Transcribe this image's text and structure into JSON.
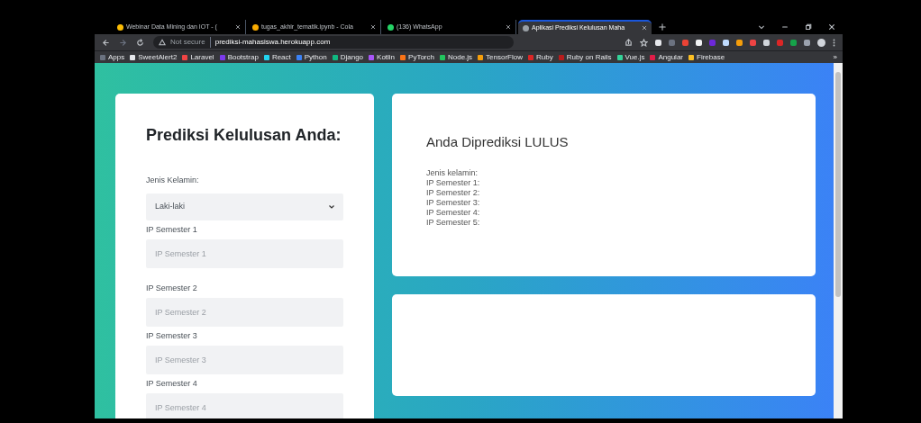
{
  "tabs": [
    {
      "title": "Webinar Data Mining dan IOT - (",
      "selected": false
    },
    {
      "title": "tugas_akhir_tematik.ipynb - Cola",
      "selected": false
    },
    {
      "title": "(136) WhatsApp",
      "selected": false
    },
    {
      "title": "Aplikasi Prediksi Kelulusan Maha",
      "selected": true
    }
  ],
  "address_bar": {
    "security": "Not secure",
    "url": "prediksi-mahasiswa.herokuapp.com"
  },
  "bookmarks": [
    {
      "label": "Apps",
      "color": "#6b7280"
    },
    {
      "label": "SweetAlert2",
      "color": "#e5e7eb"
    },
    {
      "label": "Laravel",
      "color": "#ef4444"
    },
    {
      "label": "Bootstrap",
      "color": "#7c3aed"
    },
    {
      "label": "React",
      "color": "#22d3ee"
    },
    {
      "label": "Python",
      "color": "#3b82f6"
    },
    {
      "label": "Django",
      "color": "#10b981"
    },
    {
      "label": "Kotlin",
      "color": "#a855f7"
    },
    {
      "label": "PyTorch",
      "color": "#f97316"
    },
    {
      "label": "Node.js",
      "color": "#22c55e"
    },
    {
      "label": "TensorFlow",
      "color": "#f59e0b"
    },
    {
      "label": "Ruby",
      "color": "#dc2626"
    },
    {
      "label": "Ruby on Rails",
      "color": "#b91c1c"
    },
    {
      "label": "Vue.js",
      "color": "#34d399"
    },
    {
      "label": "Angular",
      "color": "#e11d48"
    },
    {
      "label": "Firebase",
      "color": "#fbbf24"
    }
  ],
  "bookmarks_more": "»",
  "form": {
    "title": "Prediksi Kelulusan Anda:",
    "gender": {
      "label": "Jenis Kelamin:",
      "value": "Laki-laki"
    },
    "fields": [
      {
        "label": "IP Semester 1",
        "placeholder": "IP Semester 1"
      },
      {
        "label": "IP Semester 2",
        "placeholder": "IP Semester 2"
      },
      {
        "label": "IP Semester 3",
        "placeholder": "IP Semester 3"
      },
      {
        "label": "IP Semester 4",
        "placeholder": "IP Semester 4"
      }
    ]
  },
  "result": {
    "title": "Anda Diprediksi LULUS",
    "lines": [
      "Jenis kelamin:",
      "IP Semester 1:",
      "IP Semester 2:",
      "IP Semester 3:",
      "IP Semester 4:",
      "IP Semester 5:"
    ]
  }
}
